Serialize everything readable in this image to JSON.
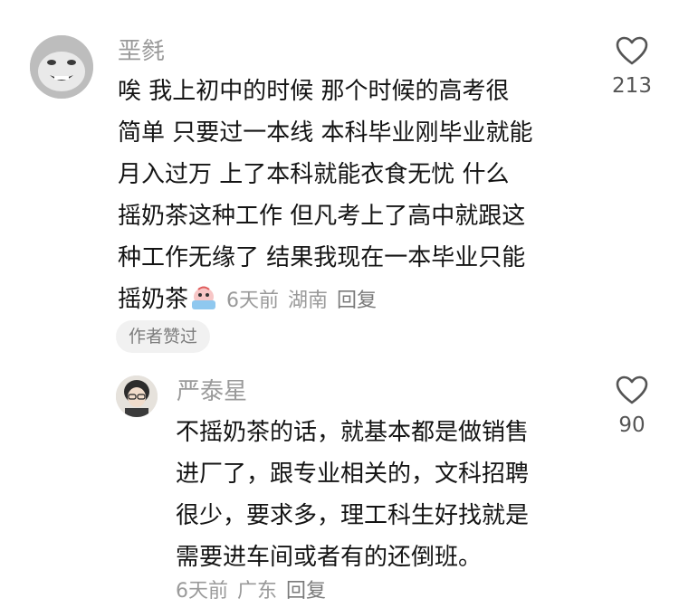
{
  "comments": [
    {
      "username": "垩毵",
      "lines": [
        "唉 我上初中的时候 那个时候的高考很",
        "简单 只要过一本线 本科毕业刚毕业就能",
        "月入过万 上了本科就能衣食无忧 什么",
        "摇奶茶这种工作 但凡考上了高中就跟这",
        "种工作无缘了 结果我现在一本毕业只能",
        "摇奶茶"
      ],
      "emoji": "crying-face-emoji",
      "time": "6天前",
      "location": "湖南",
      "reply_label": "回复",
      "badge": "作者赞过",
      "likes": "213"
    },
    {
      "username": "严泰星",
      "lines": [
        "不摇奶茶的话，就基本都是做销售",
        "进厂了，跟专业相关的，文科招聘",
        "很少，要求多，理工科生好找就是",
        "需要进车间或者有的还倒班。"
      ],
      "time": "6天前",
      "location": "广东",
      "reply_label": "回复",
      "likes": "90"
    }
  ],
  "icons": {
    "like": "heart-outline-icon"
  }
}
